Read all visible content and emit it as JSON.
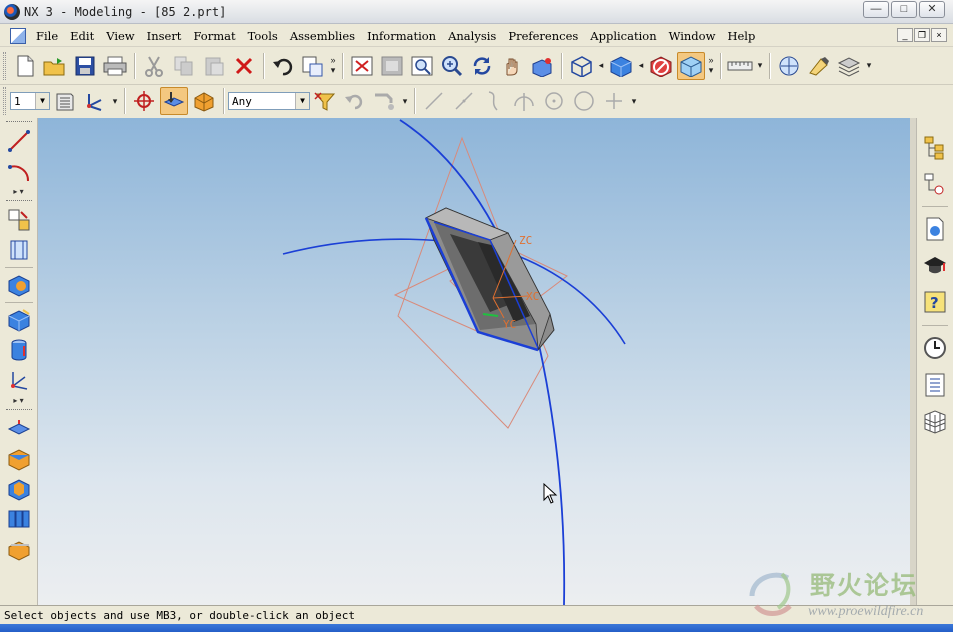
{
  "window": {
    "title": "NX 3 - Modeling - [85  2.prt]",
    "controls": [
      "—",
      "□",
      "✕"
    ],
    "mdi_controls": [
      "_",
      "❐",
      "×"
    ]
  },
  "menu": {
    "items": [
      "File",
      "Edit",
      "View",
      "Insert",
      "Format",
      "Tools",
      "Assemblies",
      "Information",
      "Analysis",
      "Preferences",
      "Application",
      "Window",
      "Help"
    ]
  },
  "toolbar2": {
    "layer_value": "1",
    "filter_value": "Any"
  },
  "viewport": {
    "axis_labels": {
      "zc": "ZC",
      "xc": "XC",
      "yc": "YC"
    },
    "colors": {
      "curve": "#1b3fd6",
      "datum_plane": "#d98a7a",
      "body_face": "#8c8c8c",
      "body_dark": "#3c3c3c",
      "axis": "#e07030"
    }
  },
  "status": {
    "prompt": "Select objects and use MB3, or double-click an object"
  },
  "watermark": {
    "cn": "野火论坛",
    "url": "www.proewildfire.cn"
  }
}
